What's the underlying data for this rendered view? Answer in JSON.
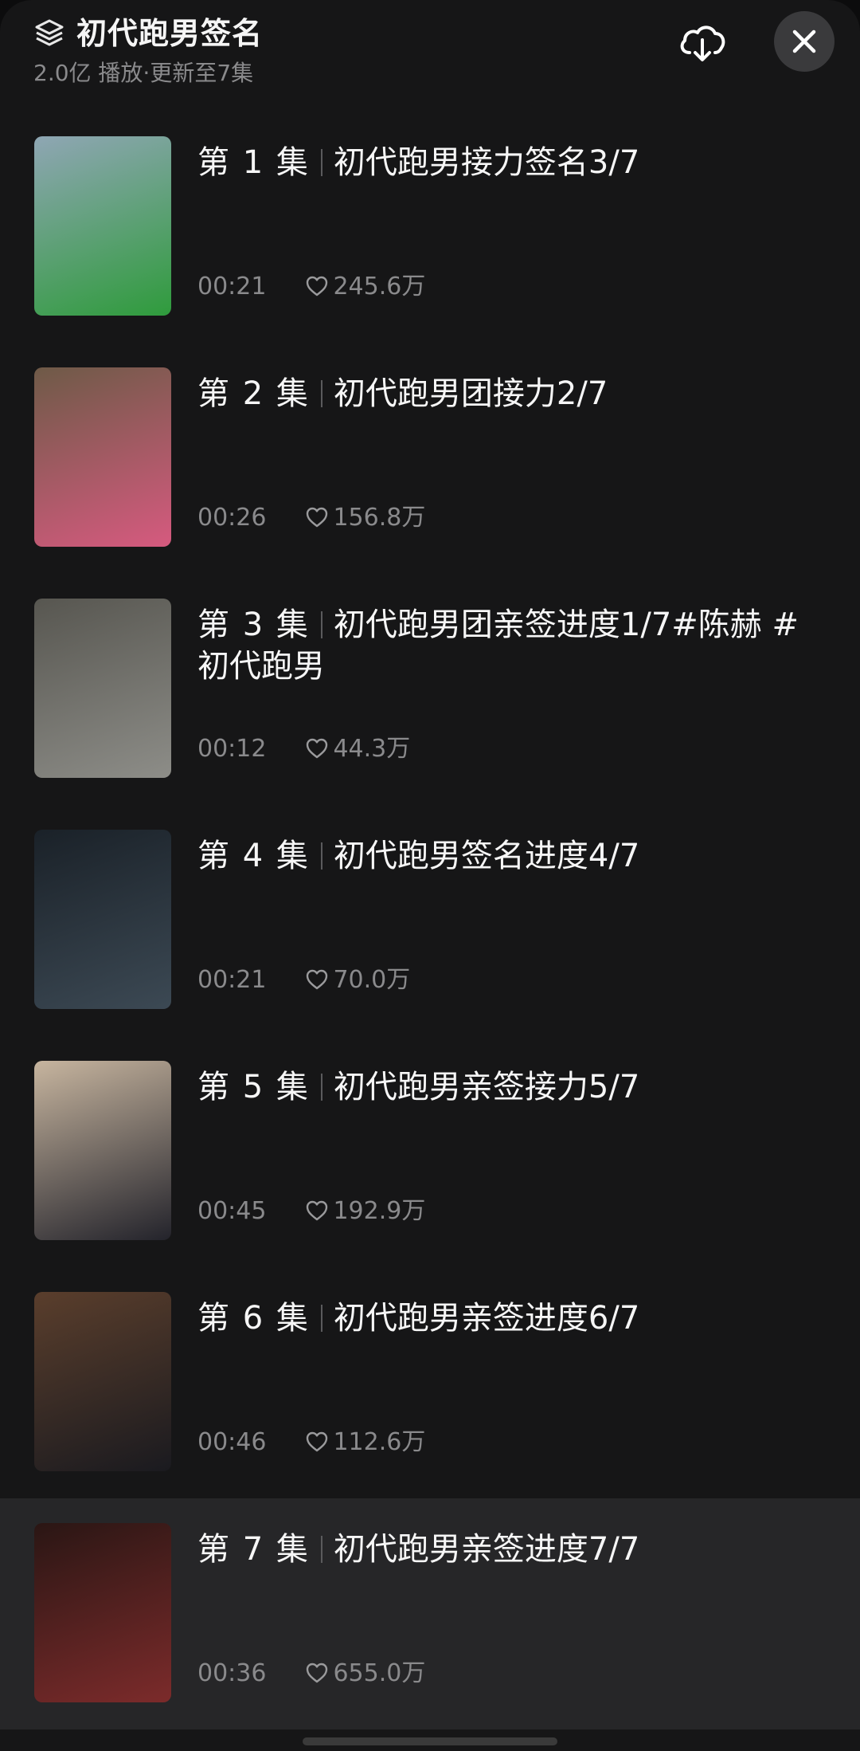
{
  "header": {
    "title": "初代跑男签名",
    "meta": "2.0亿 播放·更新至7集",
    "icons": {
      "layers": "layers-icon",
      "download": "cloud-download-icon",
      "close": "close-icon"
    }
  },
  "episodes": [
    {
      "ep": "第 1 集",
      "title": "初代跑男接力签名3/7",
      "duration": "00:21",
      "likes": "245.6万",
      "thumb_colors": [
        "#8fa6b4",
        "#2f9b3c"
      ]
    },
    {
      "ep": "第 2 集",
      "title": "初代跑男团接力2/7",
      "duration": "00:26",
      "likes": "156.8万",
      "thumb_colors": [
        "#6e5a47",
        "#d65a7f"
      ]
    },
    {
      "ep": "第 3 集",
      "title": "初代跑男团亲签进度1/7#陈赫 #初代跑男",
      "duration": "00:12",
      "likes": "44.3万",
      "thumb_colors": [
        "#575650",
        "#8d8d88"
      ]
    },
    {
      "ep": "第 4 集",
      "title": "初代跑男签名进度4/7",
      "duration": "00:21",
      "likes": "70.0万",
      "thumb_colors": [
        "#1a2128",
        "#3c4954"
      ]
    },
    {
      "ep": "第 5 集",
      "title": "初代跑男亲签接力5/7",
      "duration": "00:45",
      "likes": "192.9万",
      "thumb_colors": [
        "#c7b59f",
        "#23232b"
      ]
    },
    {
      "ep": "第 6 集",
      "title": "初代跑男亲签进度6/7",
      "duration": "00:46",
      "likes": "112.6万",
      "thumb_colors": [
        "#5a3e2c",
        "#1a1a1f"
      ]
    },
    {
      "ep": "第 7 集",
      "title": "初代跑男亲签进度7/7",
      "duration": "00:36",
      "likes": "655.0万",
      "thumb_colors": [
        "#2a1614",
        "#7c2b2b"
      ],
      "active": true
    }
  ],
  "colors": {
    "background": "#161617",
    "active_row": "#262628",
    "secondary_text": "#8a8a8c",
    "close_button": "#3a3a3c"
  }
}
